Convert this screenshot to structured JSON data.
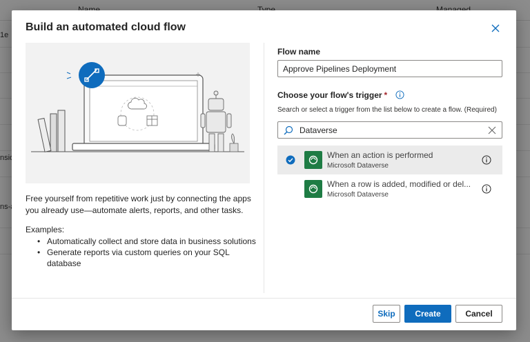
{
  "background": {
    "columns": [
      "Name",
      "Type",
      "Managed"
    ],
    "row_fragments": [
      "1e",
      "nsio",
      "ns-a"
    ]
  },
  "dialog": {
    "title": "Build an automated cloud flow",
    "close_icon": "close-icon",
    "description": "Free yourself from repetitive work just by connecting the apps you already use—automate alerts, reports, and other tasks.",
    "examples_title": "Examples:",
    "examples": [
      "Automatically collect and store data in business solutions",
      "Generate reports via custom queries on your SQL database"
    ],
    "flow_name_label": "Flow name",
    "flow_name_value": "Approve Pipelines Deployment",
    "trigger_label": "Choose your flow's trigger",
    "required_mark": "*",
    "trigger_help": "Search or select a trigger from the list below to create a flow. (Required)",
    "search_value": "Dataverse",
    "triggers": [
      {
        "name": "When an action is performed",
        "connector": "Microsoft Dataverse",
        "selected": true
      },
      {
        "name": "When a row is added, modified or del...",
        "connector": "Microsoft Dataverse",
        "selected": false
      }
    ],
    "buttons": {
      "skip": "Skip",
      "create": "Create",
      "cancel": "Cancel"
    }
  },
  "colors": {
    "primary": "#0f6cbd",
    "dataverse_tile": "#1e7c44",
    "selected_row": "#ebebeb",
    "required": "#a4262c"
  }
}
